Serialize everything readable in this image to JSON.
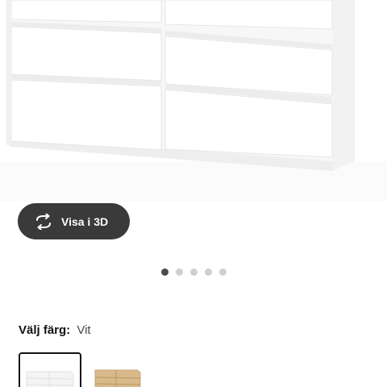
{
  "view3d": {
    "label": "Visa i 3D",
    "icon": "rotate-3d-icon"
  },
  "carousel": {
    "count": 5,
    "active": 1
  },
  "color": {
    "label": "Välj färg:",
    "value": "Vit"
  },
  "swatches": [
    {
      "name": "white",
      "selected": true
    },
    {
      "name": "oak",
      "selected": false
    }
  ],
  "colors": {
    "button_bg": "#3a3a3a",
    "dot_active": "#4a4a4a",
    "dot_inactive": "#cfcfcf",
    "oak": "#d8b98a"
  }
}
